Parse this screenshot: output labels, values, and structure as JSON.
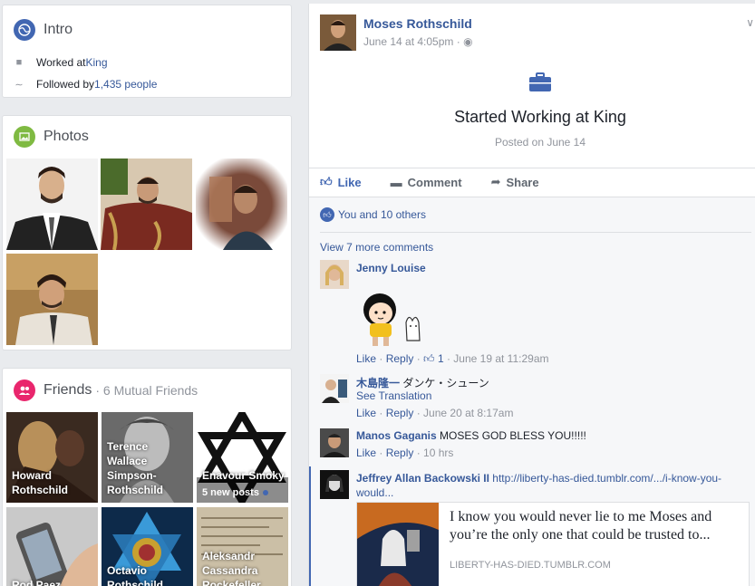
{
  "intro": {
    "title": "Intro",
    "worked_prefix": "Worked at ",
    "worked_place": "King",
    "followed_prefix": "Followed by ",
    "followed_count": "1,435 people"
  },
  "photos": {
    "title": "Photos"
  },
  "friends": {
    "title": "Friends",
    "mutual": "· 6 Mutual Friends",
    "tiles": [
      {
        "name": "Howard Rothschild"
      },
      {
        "name": "Terence Wallace Simpson-Rothschild"
      },
      {
        "name": "Enavour Smoky",
        "posts": "5 new posts"
      },
      {
        "name": "Rod Paez"
      },
      {
        "name": "Octavio Rothschild"
      },
      {
        "name": "Aleksandr Cassandra Rockefeller"
      }
    ]
  },
  "post": {
    "author": "Moses Rothschild",
    "time": "June 14 at 4:05pm ·",
    "life_event_title": "Started Working at King",
    "life_event_sub": "Posted on June 14",
    "actions": {
      "like": "Like",
      "comment": "Comment",
      "share": "Share"
    },
    "reactions": "You and 10 others",
    "view_more": "View 7 more comments",
    "comments": [
      {
        "name": "Jenny Louise",
        "text": "",
        "like": "Like",
        "reply": "Reply",
        "likes": "1",
        "time": "June 19 at 11:29am"
      },
      {
        "name": "木島隆一",
        "text": "ダンケ・シューン",
        "translate": "See Translation",
        "like": "Like",
        "reply": "Reply",
        "time": "June 20 at 8:17am"
      },
      {
        "name": "Manos Gaganis",
        "text": "MOSES GOD BLESS YOU!!!!!",
        "like": "Like",
        "reply": "Reply",
        "time": "10 hrs"
      },
      {
        "name": "Jeffrey Allan Backowski II",
        "text": "http://liberty-has-died.tumblr.com/.../i-know-you-would...",
        "link_quote": "I know you would never lie to me Moses and you’re the only one that could be trusted to...",
        "link_domain": "LIBERTY-HAS-DIED.TUMBLR.COM"
      }
    ]
  },
  "colors": {
    "brand": "#4267b2",
    "link": "#365899",
    "bg": "#e9ebee"
  }
}
